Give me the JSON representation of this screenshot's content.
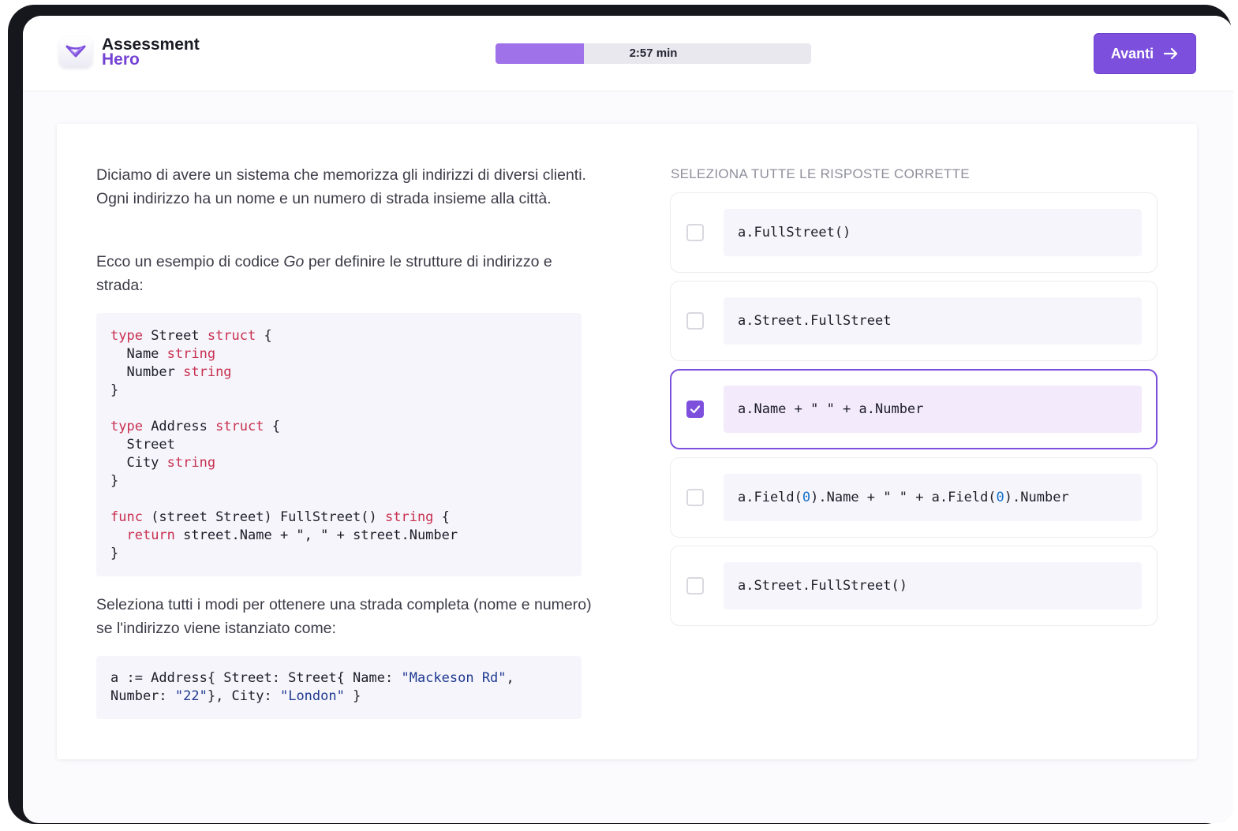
{
  "brand": {
    "name_line1": "Assessment",
    "name_line2": "Hero"
  },
  "timer": {
    "label": "2:57 min",
    "progress_fraction": 0.28
  },
  "next_button": {
    "label": "Avanti"
  },
  "question": {
    "paragraph1": "Diciamo di avere un sistema che memorizza gli indirizzi di diversi clienti. Ogni indirizzo ha un nome e un numero di strada insieme alla città.",
    "paragraph2_before": "Ecco un esempio di codice ",
    "paragraph2_lang": "Go",
    "paragraph2_after": " per definire le strutture di indirizzo e strada:",
    "code_lines": [
      [
        [
          "kw",
          "type"
        ],
        [
          "t",
          " Street "
        ],
        [
          "kw",
          "struct"
        ],
        [
          "t",
          " {"
        ]
      ],
      [
        [
          "t",
          "  Name "
        ],
        [
          "kw",
          "string"
        ]
      ],
      [
        [
          "t",
          "  Number "
        ],
        [
          "kw",
          "string"
        ]
      ],
      [
        [
          "t",
          "}"
        ]
      ],
      [
        [
          "t",
          ""
        ]
      ],
      [
        [
          "kw",
          "type"
        ],
        [
          "t",
          " Address "
        ],
        [
          "kw",
          "struct"
        ],
        [
          "t",
          " {"
        ]
      ],
      [
        [
          "t",
          "  Street"
        ]
      ],
      [
        [
          "t",
          "  City "
        ],
        [
          "kw",
          "string"
        ]
      ],
      [
        [
          "t",
          "}"
        ]
      ],
      [
        [
          "t",
          ""
        ]
      ],
      [
        [
          "kw",
          "func"
        ],
        [
          "t",
          " (street Street) FullStreet() "
        ],
        [
          "kw",
          "string"
        ],
        [
          "t",
          " {"
        ]
      ],
      [
        [
          "t",
          "  "
        ],
        [
          "kw",
          "return"
        ],
        [
          "t",
          " street.Name + \", \" + street.Number"
        ]
      ],
      [
        [
          "t",
          "}"
        ]
      ]
    ],
    "paragraph3": "Seleziona tutti i modi per ottenere una strada completa (nome e numero) se l'indirizzo viene istanziato come:",
    "instance_lines": [
      [
        [
          "t",
          "a := Address{ Street: Street{ Name: "
        ],
        [
          "str",
          "\"Mackeson Rd\""
        ],
        [
          "t",
          ","
        ]
      ],
      [
        [
          "t",
          "Number: "
        ],
        [
          "str",
          "\"22\""
        ],
        [
          "t",
          "}, City: "
        ],
        [
          "str",
          "\"London\""
        ],
        [
          "t",
          " }"
        ]
      ]
    ]
  },
  "answers": {
    "title": "SELEZIONA TUTTE LE RISPOSTE CORRETTE",
    "options": [
      {
        "segments": [
          [
            "t",
            "a.FullStreet()"
          ]
        ],
        "checked": false
      },
      {
        "segments": [
          [
            "t",
            "a.Street.FullStreet"
          ]
        ],
        "checked": false
      },
      {
        "segments": [
          [
            "t",
            "a.Name + \" \" + a.Number"
          ]
        ],
        "checked": true
      },
      {
        "segments": [
          [
            "t",
            "a.Field("
          ],
          [
            "num",
            "0"
          ],
          [
            "t",
            ").Name + \" \" + a.Field("
          ],
          [
            "num",
            "0"
          ],
          [
            "t",
            ").Number"
          ]
        ],
        "checked": false
      },
      {
        "segments": [
          [
            "t",
            "a.Street.FullStreet()"
          ]
        ],
        "checked": false
      }
    ]
  },
  "colors": {
    "accent": "#7c4fdd",
    "progress": "#9f72ea",
    "keyword": "#c8304f",
    "string": "#1f3a8f",
    "number": "#1570c8"
  },
  "icons": {
    "logo": "chevron-check-icon",
    "next": "arrow-right-icon",
    "check": "check-icon"
  }
}
